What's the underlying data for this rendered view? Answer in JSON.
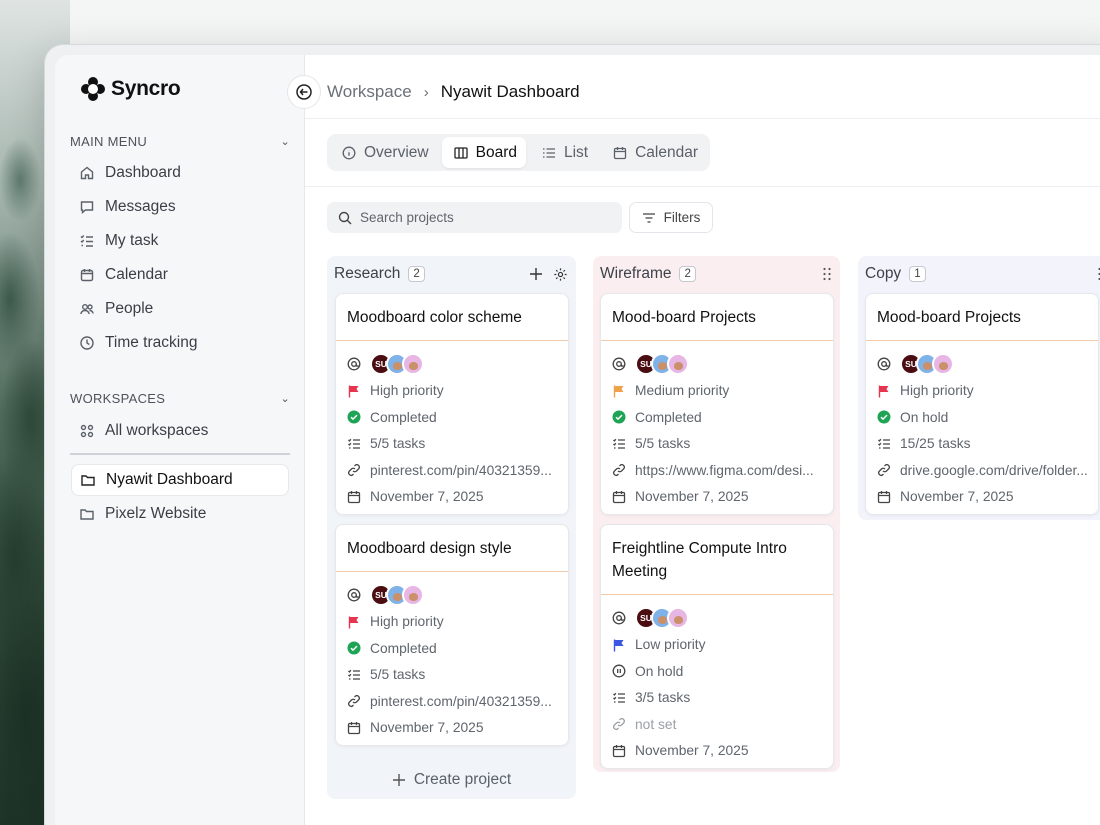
{
  "app": {
    "name": "Syncro"
  },
  "sidebar": {
    "main_menu_label": "MAIN MENU",
    "main_items": [
      {
        "label": "Dashboard",
        "icon": "home-icon"
      },
      {
        "label": "Messages",
        "icon": "message-icon"
      },
      {
        "label": "My task",
        "icon": "checklist-icon"
      },
      {
        "label": "Calendar",
        "icon": "calendar-icon"
      },
      {
        "label": "People",
        "icon": "people-icon"
      },
      {
        "label": "Time tracking",
        "icon": "clock-icon"
      }
    ],
    "workspaces_label": "WORKSPACES",
    "all_workspaces": "All workspaces",
    "workspaces": [
      {
        "label": "Nyawit Dashboard",
        "active": true
      },
      {
        "label": "Pixelz Website",
        "active": false
      }
    ]
  },
  "breadcrumb": {
    "parent": "Workspace",
    "current": "Nyawit Dashboard"
  },
  "view_tabs": [
    {
      "label": "Overview",
      "icon": "info-icon"
    },
    {
      "label": "Board",
      "icon": "board-icon",
      "active": true
    },
    {
      "label": "List",
      "icon": "list-icon"
    },
    {
      "label": "Calendar",
      "icon": "calendar-icon"
    }
  ],
  "toolbar": {
    "search_placeholder": "Search projects",
    "filters_label": "Filters"
  },
  "columns": [
    {
      "name": "Research",
      "count": "2",
      "create_label": "Create project",
      "cards": [
        {
          "title": "Moodboard color scheme",
          "avatar_initials": "SU",
          "priority": "High priority",
          "priority_color": "#e5354f",
          "status": "Completed",
          "tasks": "5/5 tasks",
          "link": "pinterest.com/pin/40321359...",
          "date": "November 7, 2025"
        },
        {
          "title": "Moodboard design style",
          "avatar_initials": "SU",
          "priority": "High priority",
          "priority_color": "#e5354f",
          "status": "Completed",
          "tasks": "5/5 tasks",
          "link": "pinterest.com/pin/40321359...",
          "date": "November 7, 2025"
        }
      ]
    },
    {
      "name": "Wireframe",
      "count": "2",
      "cards": [
        {
          "title": "Mood-board Projects",
          "avatar_initials": "SU",
          "priority": "Medium priority",
          "priority_color": "#f0a24a",
          "status": "Completed",
          "tasks": "5/5 tasks",
          "link": "https://www.figma.com/desi...",
          "date": "November 7, 2025"
        },
        {
          "title": "Freightline Compute Intro Meeting",
          "avatar_initials": "SU",
          "priority": "Low priority",
          "priority_color": "#3b56e0",
          "status": "On hold",
          "tasks": "3/5 tasks",
          "link": "not set",
          "date": "November 7, 2025"
        }
      ]
    },
    {
      "name": "Copy",
      "count": "1",
      "cards": [
        {
          "title": "Mood-board Projects",
          "avatar_initials": "SU",
          "priority": "High priority",
          "priority_color": "#e5354f",
          "status": "On hold",
          "tasks": "15/25 tasks",
          "link": "drive.google.com/drive/folder...",
          "date": "November 7, 2025"
        }
      ]
    }
  ],
  "colors": {
    "completed": "#1fa456",
    "accent_line": "#f3c9a8"
  }
}
